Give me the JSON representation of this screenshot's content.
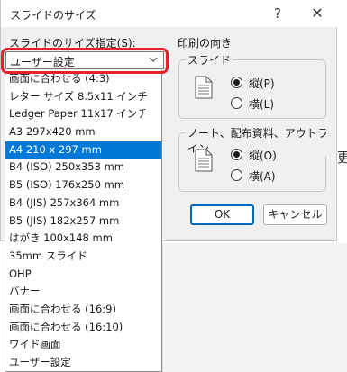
{
  "dialog": {
    "title": "スライドのサイズ",
    "help_glyph": "?",
    "close_glyph": "✕"
  },
  "slide_size": {
    "label": "スライドのサイズ指定(S):",
    "selected_value": "ユーザー設定",
    "options": [
      "画面に合わせる (4:3)",
      "レター サイズ 8.5x11 インチ",
      "Ledger Paper 11x17 インチ",
      "A3 297x420 mm",
      "A4 210 x 297 mm",
      "B4 (ISO) 250x353 mm",
      "B5 (ISO) 176x250 mm",
      "B4 (JIS) 257x364 mm",
      "B5 (JIS) 182x257 mm",
      "はがき 100x148 mm",
      "35mm スライド",
      "OHP",
      "バナー",
      "画面に合わせる (16:9)",
      "画面に合わせる (16:10)",
      "ワイド画面",
      "ユーザー設定"
    ],
    "highlighted_index": 4
  },
  "orientation": {
    "title": "印刷の向き",
    "slides": {
      "label": "スライド",
      "portrait_label": "縦(P)",
      "landscape_label": "横(L)",
      "selected": "portrait"
    },
    "notes": {
      "label": "ノート、配布資料、アウトライン",
      "portrait_label": "縦(O)",
      "landscape_label": "横(A)",
      "selected": "portrait"
    }
  },
  "buttons": {
    "ok": "OK",
    "cancel": "キャンセル"
  },
  "background": {
    "text_fragment": "更"
  },
  "colors": {
    "highlight_ring": "#e8202a",
    "selection": "#0078d7",
    "default_button_border": "#0067c0"
  }
}
